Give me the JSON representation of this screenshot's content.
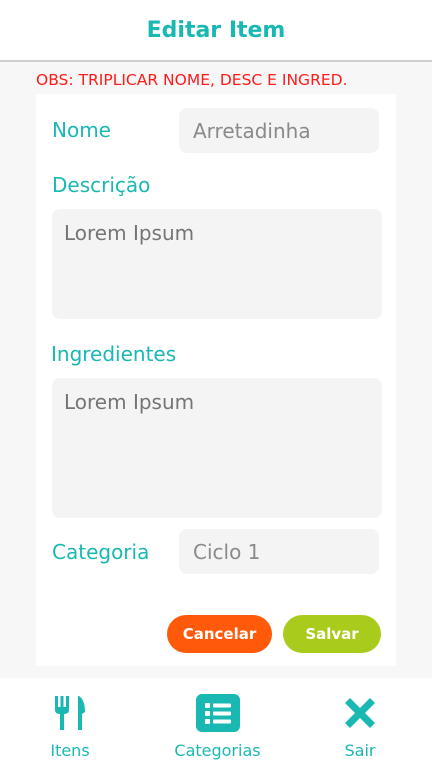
{
  "header": {
    "title": "Editar Item"
  },
  "note": "OBS: TRIPLICAR NOME, DESC E INGRED.",
  "form": {
    "name_label": "Nome",
    "name_value": "Arretadinha",
    "description_label": "Descrição",
    "description_placeholder": "Lorem Ipsum",
    "ingredients_label": "Ingredientes",
    "ingredients_placeholder": "Lorem Ipsum",
    "category_label": "Categoria",
    "category_value": "Ciclo 1"
  },
  "actions": {
    "cancel_label": "Cancelar",
    "save_label": "Salvar"
  },
  "nav": {
    "items": [
      {
        "label": "Itens",
        "icon": "utensils-icon"
      },
      {
        "label": "Categorias",
        "icon": "list-icon"
      },
      {
        "label": "Sair",
        "icon": "close-icon"
      }
    ]
  },
  "colors": {
    "accent": "#1ab8b3",
    "note": "#ff1a1a",
    "cancel": "#ff5a0a",
    "save": "#a9cc1c"
  }
}
